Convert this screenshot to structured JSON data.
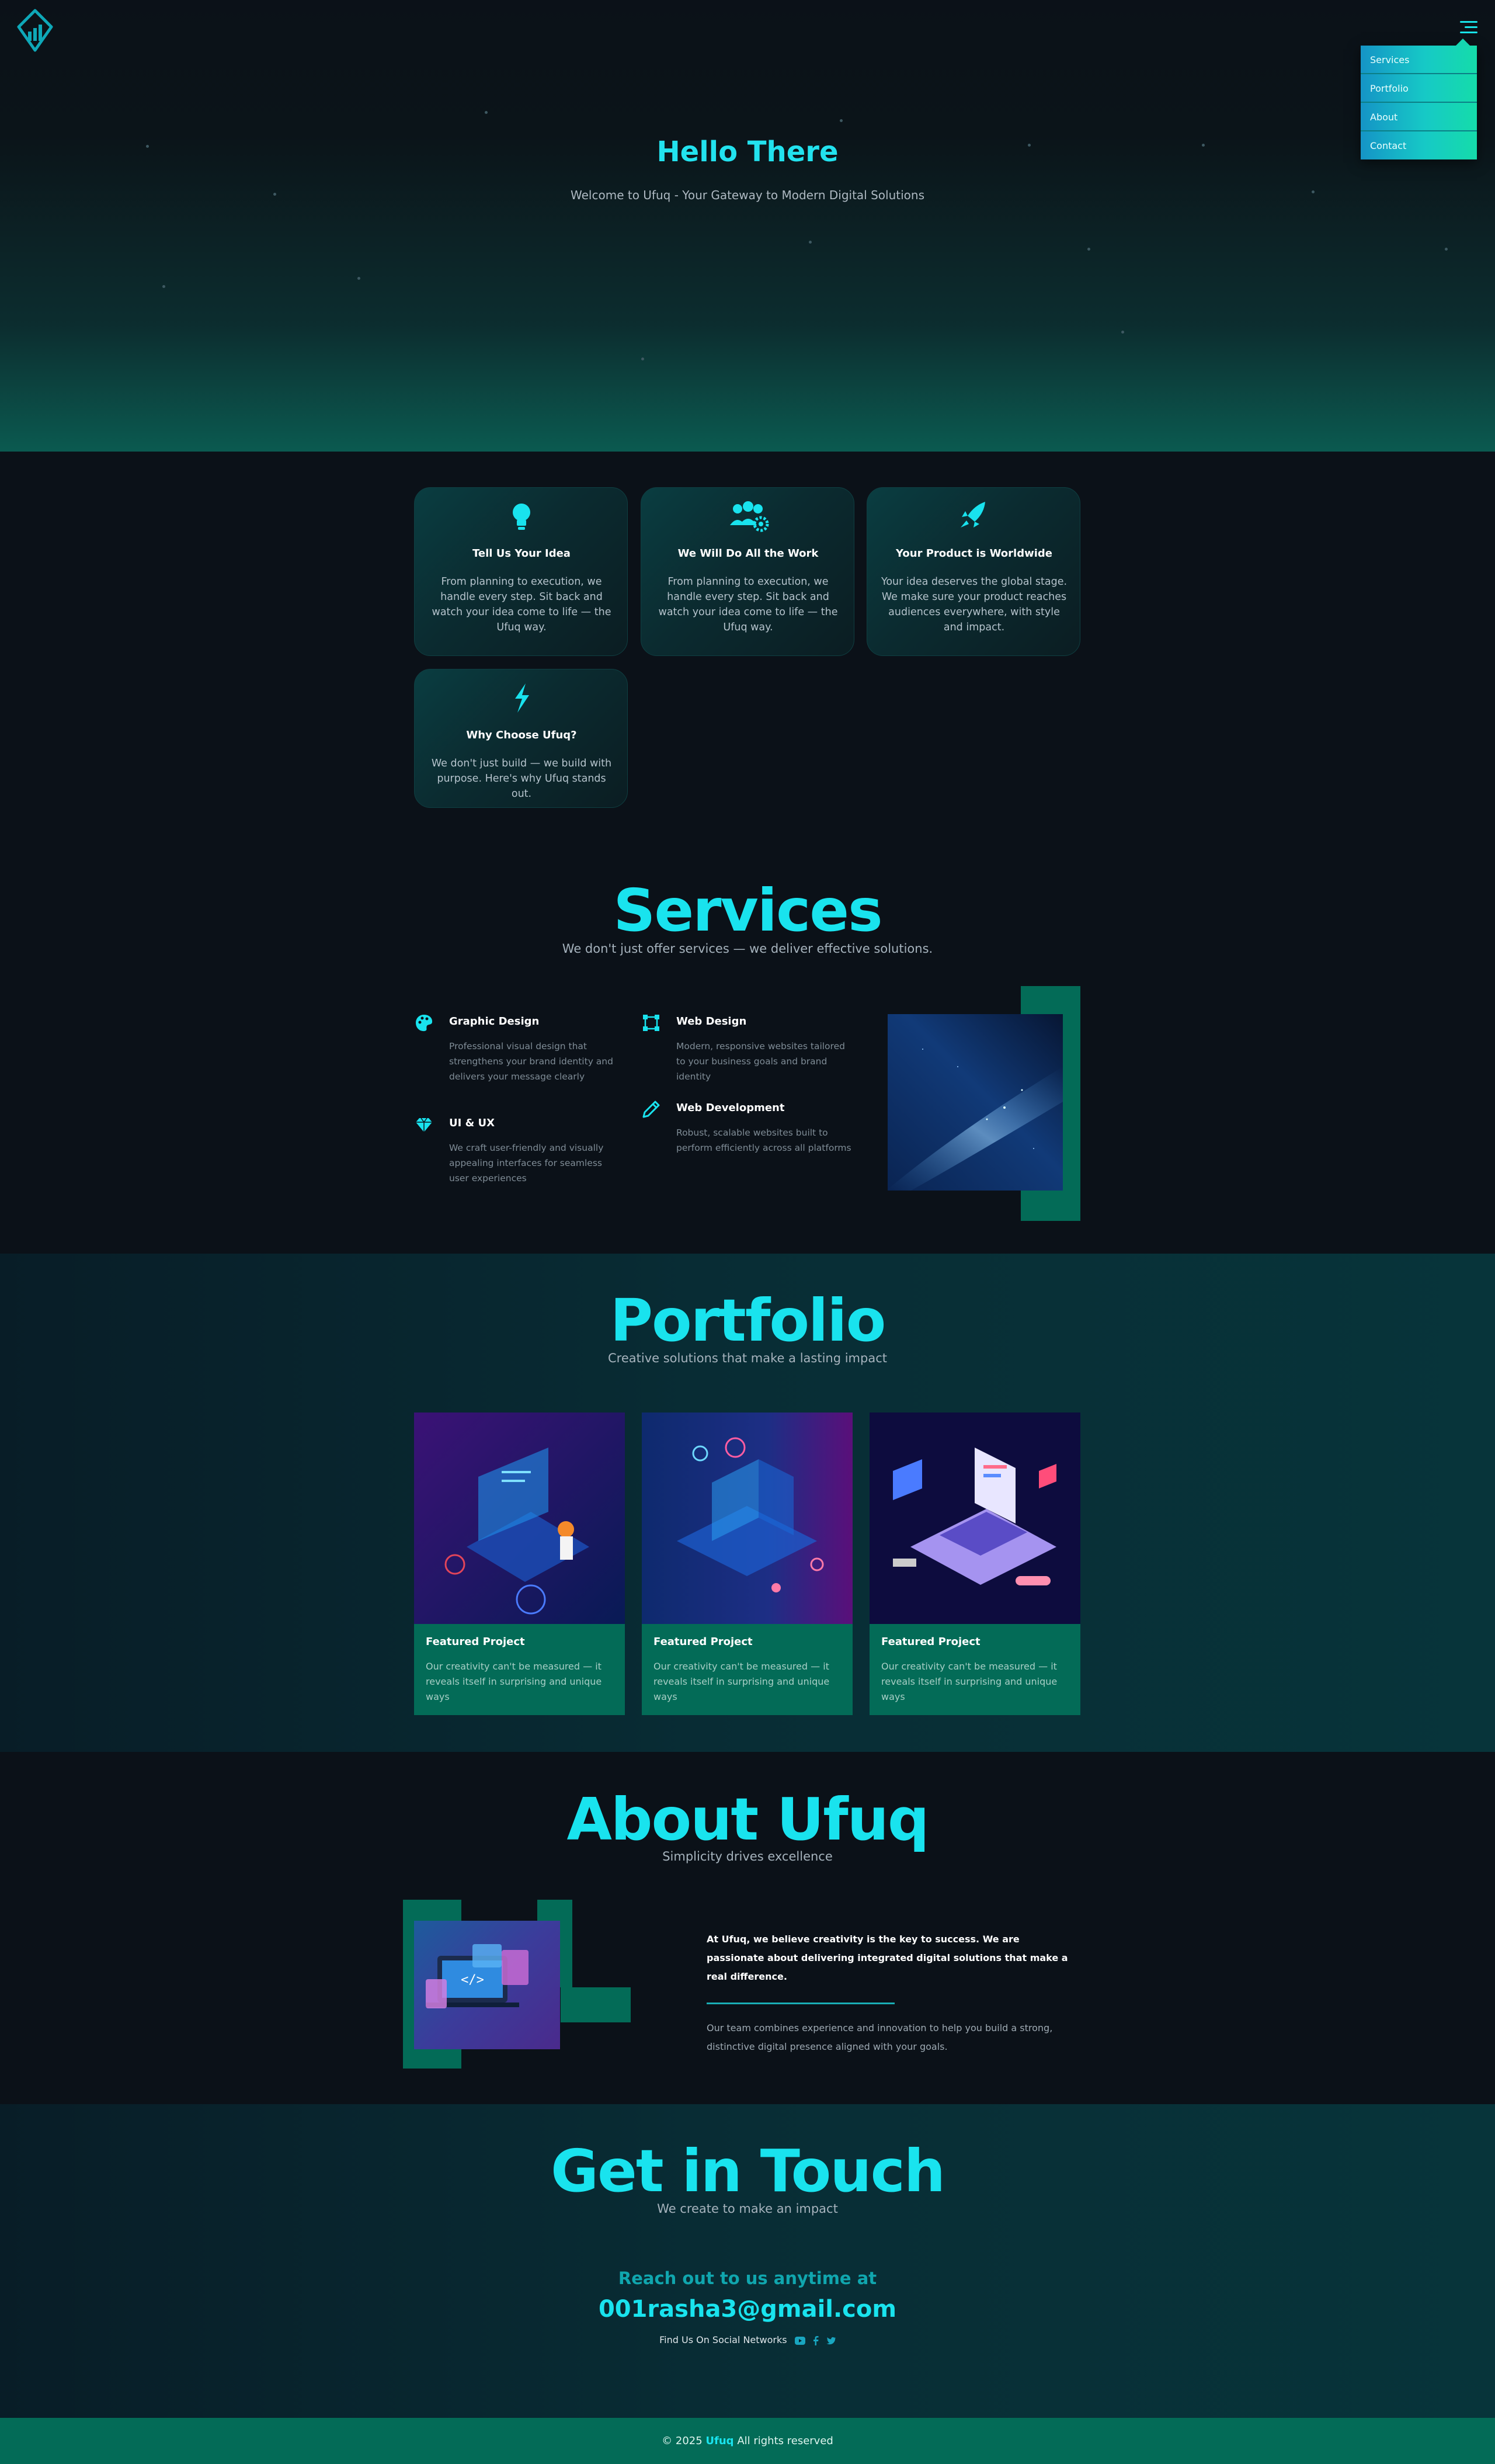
{
  "nav": {
    "menu_items": [
      "Services",
      "Portfolio",
      "About",
      "Contact"
    ]
  },
  "hero": {
    "title": "Hello There",
    "subtitle": "Welcome to Ufuq - Your Gateway to Modern Digital Solutions"
  },
  "features": [
    {
      "icon": "lightbulb-icon",
      "title": "Tell Us Your Idea",
      "text": "From planning to execution, we handle every step. Sit back and watch your idea come to life — the Ufuq way."
    },
    {
      "icon": "team-gear-icon",
      "title": "We Will Do All the Work",
      "text": "From planning to execution, we handle every step. Sit back and watch your idea come to life — the Ufuq way."
    },
    {
      "icon": "rocket-icon",
      "title": "Your Product is Worldwide",
      "text": "Your idea deserves the global stage. We make sure your product reaches audiences everywhere, with style and impact."
    },
    {
      "icon": "lightning-icon",
      "title": "Why Choose Ufuq?",
      "text": "We don't just build — we build with purpose. Here's why Ufuq stands out."
    }
  ],
  "services": {
    "title": "Services",
    "subtitle": "We don't just offer services — we deliver effective solutions.",
    "items": [
      {
        "icon": "palette-icon",
        "title": "Graphic Design",
        "text": "Professional visual design that strengthens your brand identity and delivers your message clearly"
      },
      {
        "icon": "vector-square-icon",
        "title": "Web Design",
        "text": "Modern, responsive websites tailored to your business goals and brand identity"
      },
      {
        "icon": "gem-icon",
        "title": "UI & UX",
        "text": "We craft user-friendly and visually appealing interfaces for seamless user experiences"
      },
      {
        "icon": "pen-icon",
        "title": "Web Development",
        "text": "Robust, scalable websites built to perform efficiently across all platforms"
      }
    ]
  },
  "portfolio": {
    "title": "Portfolio",
    "subtitle": "Creative solutions that make a lasting impact",
    "items": [
      {
        "title": "Featured Project",
        "text": "Our creativity can't be measured — it reveals itself in surprising and unique ways"
      },
      {
        "title": "Featured Project",
        "text": "Our creativity can't be measured — it reveals itself in surprising and unique ways"
      },
      {
        "title": "Featured Project",
        "text": "Our creativity can't be measured — it reveals itself in surprising and unique ways"
      }
    ]
  },
  "about": {
    "title": "About Ufuq",
    "subtitle": "Simplicity drives excellence",
    "lead": "At Ufuq, we believe creativity is the key to success. We are passionate about delivering integrated digital solutions that make a real difference.",
    "body": "Our team combines experience and innovation to help you build a strong, distinctive digital presence aligned with your goals."
  },
  "contact": {
    "title": "Get in Touch",
    "subtitle": "We create to make an impact",
    "reach": "Reach out to us anytime at",
    "email": "001rasha3@gmail.com",
    "social_label": "Find Us On Social Networks",
    "social_icons": [
      "youtube-icon",
      "facebook-icon",
      "twitter-icon"
    ]
  },
  "footer": {
    "prefix": "© 2025",
    "brand": "Ufuq",
    "suffix": "All rights reserved"
  },
  "colors": {
    "accent": "#19e3ee",
    "brand_green": "#036b57",
    "background": "#0b1118"
  }
}
